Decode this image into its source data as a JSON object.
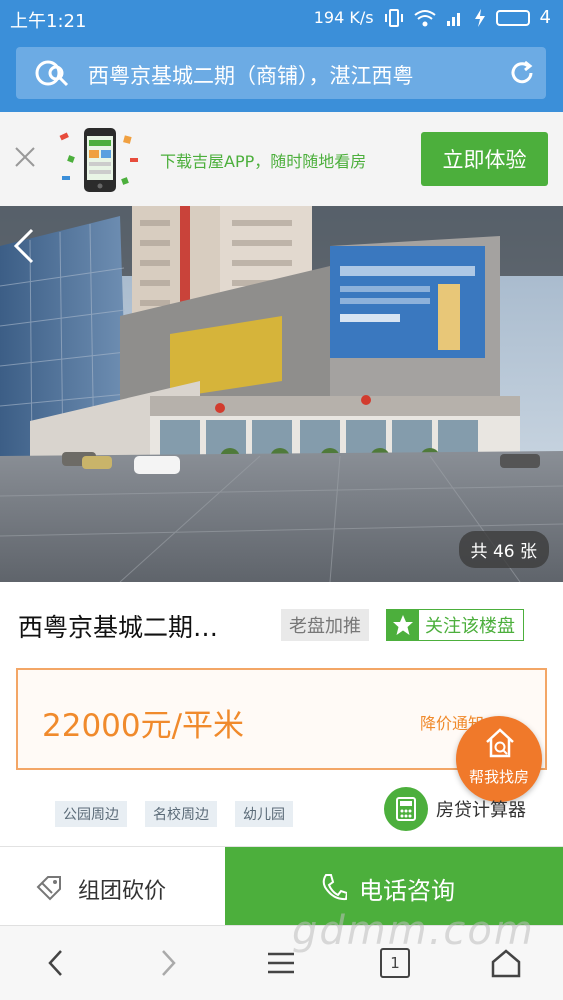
{
  "status_bar": {
    "time": "上午1:21",
    "speed": "194 K/s",
    "battery": "4"
  },
  "search": {
    "query": "西粤京基城二期（商铺），湛江西粤"
  },
  "app_banner": {
    "promo": "下载吉屋APP，随时随地看房",
    "cta": "立即体验"
  },
  "gallery": {
    "photo_count": "共 46 张"
  },
  "listing": {
    "title": "西粤京基城二期…",
    "tag": "老盘加推",
    "follow": "关注该楼盘",
    "price": "22000元/平米",
    "price_notify": "降价通知"
  },
  "fab": {
    "label": "帮我找房"
  },
  "tags": [
    "公园周边",
    "名校周边",
    "幼儿园"
  ],
  "calculator": {
    "label": "房贷计算器"
  },
  "actions": {
    "group_buy": "组团砍价",
    "call": "电话咨询"
  },
  "browser_nav": {
    "tab_count": "1"
  },
  "watermark": "gdmm.com",
  "colors": {
    "brand_blue": "#3b8fd9",
    "accent_green": "#4caf3c",
    "price_orange": "#f08a2c",
    "fab_orange": "#f0792a"
  }
}
